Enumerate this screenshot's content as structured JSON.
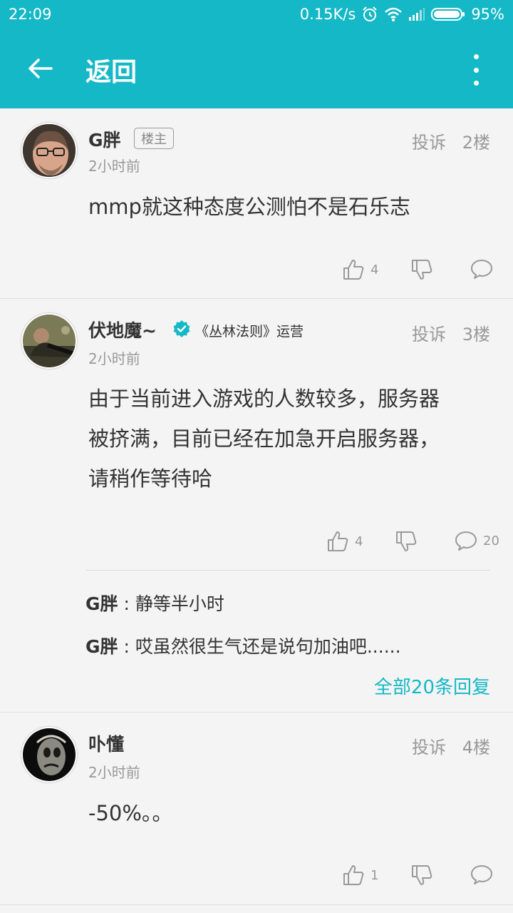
{
  "status_bar": {
    "time": "22:09",
    "network_speed": "0.15K/s",
    "battery": "95%"
  },
  "toolbar": {
    "title": "返回"
  },
  "colors": {
    "accent": "#15b8c6"
  },
  "posts": [
    {
      "username": "G胖",
      "badge": "楼主",
      "time": "2小时前",
      "report": "投诉",
      "floor": "2楼",
      "content": "mmp就这种态度公测怕不是石乐志",
      "likes": "4",
      "comments": ""
    },
    {
      "username": "伏地魔~",
      "role": "《丛林法则》运营",
      "time": "2小时前",
      "report": "投诉",
      "floor": "3楼",
      "content_lines": [
        "由于当前进入游戏的人数较多，服务器",
        "被挤满，目前已经在加急开启服务器，",
        "请稍作等待哈"
      ],
      "likes": "4",
      "comments": "20",
      "replies": [
        {
          "author": "G胖",
          "sep": " : ",
          "text": "静等半小时"
        },
        {
          "author": "G胖",
          "sep": " : ",
          "text": "哎虽然很生气还是说句加油吧......"
        }
      ],
      "all_replies": "全部20条回复"
    },
    {
      "username": "卟懂",
      "time": "2小时前",
      "report": "投诉",
      "floor": "4楼",
      "content": "-50%。。",
      "likes": "1",
      "comments": ""
    }
  ]
}
